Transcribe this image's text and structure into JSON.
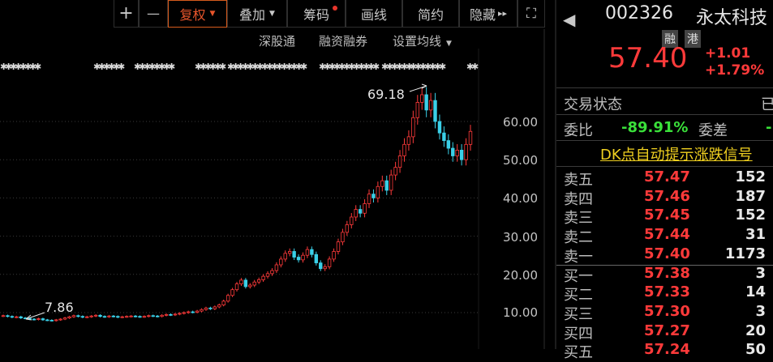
{
  "toolbar": {
    "plus": "+",
    "minus": "—",
    "fuquan": "复权",
    "diejia": "叠加",
    "chouma": "筹码",
    "huaxian": "画线",
    "jianyue": "简约",
    "yincang": "隐藏",
    "more": "▸▸",
    "fullscreen": "⛶"
  },
  "subbar": {
    "shengutong": "深股通",
    "rongzi": "融资融券",
    "junxian": "设置均线"
  },
  "chart_data": {
    "type": "candlestick",
    "y_ticks": [
      "60.00",
      "50.00",
      "40.00",
      "30.00",
      "20.00",
      "10.00"
    ],
    "y_tick_values": [
      60,
      50,
      40,
      30,
      20,
      10
    ],
    "annotations": [
      {
        "text": "69.18",
        "kind": "high"
      },
      {
        "text": "7.86",
        "kind": "low"
      }
    ],
    "closes": [
      9.2,
      9.0,
      8.8,
      8.9,
      8.6,
      8.5,
      8.3,
      8.2,
      8.4,
      8.1,
      8.0,
      7.9,
      8.1,
      8.3,
      8.6,
      8.9,
      9.2,
      9.0,
      8.8,
      8.9,
      9.1,
      9.3,
      9.0,
      8.9,
      9.1,
      9.0,
      8.8,
      8.9,
      9.0,
      9.1,
      9.0,
      8.9,
      9.0,
      9.2,
      9.1,
      9.0,
      9.3,
      9.5,
      9.4,
      9.6,
      9.8,
      10.0,
      10.2,
      10.1,
      10.4,
      10.8,
      11.2,
      11.0,
      11.5,
      12.0,
      13.0,
      14.5,
      16.0,
      17.5,
      18.5,
      16.8,
      17.2,
      18.0,
      18.6,
      19.5,
      20.2,
      21.0,
      22.5,
      24.0,
      25.5,
      26.0,
      24.5,
      23.8,
      25.0,
      26.5,
      25.2,
      23.0,
      21.5,
      22.0,
      24.0,
      26.0,
      28.5,
      31.0,
      33.0,
      35.0,
      37.0,
      36.0,
      38.5,
      41.0,
      40.0,
      43.0,
      44.5,
      42.0,
      46.0,
      48.0,
      51.0,
      54.0,
      56.0,
      61.0,
      65.0,
      67.0,
      63.0,
      65.5,
      60.0,
      57.0,
      55.0,
      53.0,
      51.0,
      52.5,
      50.0,
      54.0,
      57.4
    ]
  },
  "quote": {
    "code": "002326",
    "name": "永太科技",
    "badge1": "融",
    "badge2": "港",
    "price": "57.40",
    "change": "+1.01",
    "change_pct": "+1.79%",
    "trade_state_label": "交易状态",
    "trade_state_value": "已",
    "weibi_label": "委比",
    "weibi_value": "-89.91%",
    "weicha_label": "委差",
    "weicha_value": "-",
    "dk_signal": "DK点自动提示涨跌信号"
  },
  "orderbook": {
    "asks": [
      {
        "name": "卖五",
        "price": "57.47",
        "vol": "152"
      },
      {
        "name": "卖四",
        "price": "57.46",
        "vol": "187"
      },
      {
        "name": "卖三",
        "price": "57.45",
        "vol": "152"
      },
      {
        "name": "卖二",
        "price": "57.44",
        "vol": "31"
      },
      {
        "name": "卖一",
        "price": "57.40",
        "vol": "1173"
      }
    ],
    "bids": [
      {
        "name": "买一",
        "price": "57.38",
        "vol": "3"
      },
      {
        "name": "买二",
        "price": "57.33",
        "vol": "14"
      },
      {
        "name": "买三",
        "price": "57.30",
        "vol": "3"
      },
      {
        "name": "买四",
        "price": "57.27",
        "vol": "20"
      },
      {
        "name": "买五",
        "price": "57.24",
        "vol": "50"
      }
    ]
  },
  "colors": {
    "up": "#ff3a3a",
    "down": "#3ad0e8",
    "accent": "#d65b1d"
  }
}
